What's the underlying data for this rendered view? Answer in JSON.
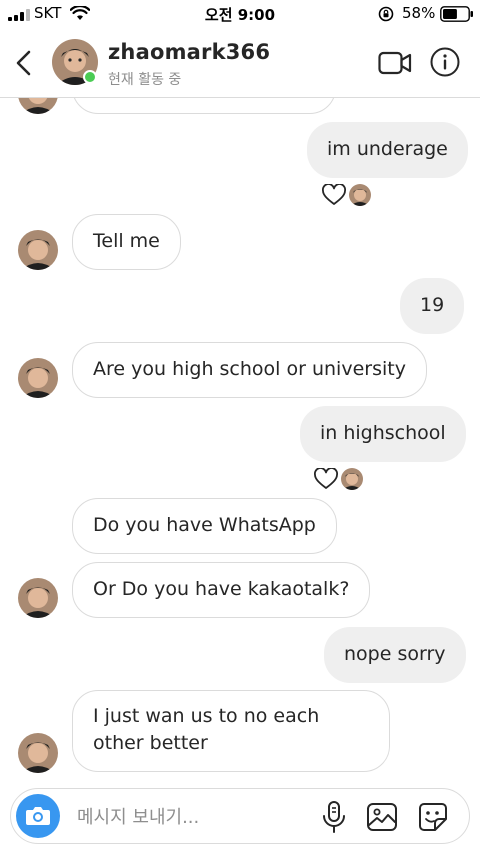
{
  "status_bar": {
    "carrier": "SKT",
    "time": "오전 9:00",
    "battery_percent": "58%",
    "battery_level": 0.58
  },
  "header": {
    "username": "zhaomark366",
    "active_status": "현재 활동 중",
    "online": true
  },
  "messages": [
    {
      "side": "out",
      "text": "im underage",
      "reaction": "heart-icon"
    },
    {
      "side": "in",
      "text": "Tell me"
    },
    {
      "side": "out",
      "text": "19"
    },
    {
      "side": "in",
      "text": "Are you high school or university"
    },
    {
      "side": "out",
      "text": "in highschool",
      "reaction": "heart-icon"
    },
    {
      "side": "in",
      "text": "Do you have WhatsApp"
    },
    {
      "side": "in",
      "text": "Or Do you have kakaotalk?"
    },
    {
      "side": "out",
      "text": "nope sorry"
    },
    {
      "side": "in",
      "text": "I just wan us to no each other better"
    }
  ],
  "composer": {
    "placeholder": "메시지 보내기..."
  },
  "colors": {
    "accent": "#3897f0",
    "online": "#4bcc54",
    "outgoing_bubble": "#efefef",
    "incoming_border": "#dbdbdb",
    "text": "#262626",
    "secondary_text": "#8e8e8e"
  },
  "icons": [
    "back-chevron-icon",
    "video-camera-icon",
    "info-icon",
    "heart-icon",
    "camera-icon",
    "microphone-icon",
    "gallery-icon",
    "sticker-icon"
  ]
}
